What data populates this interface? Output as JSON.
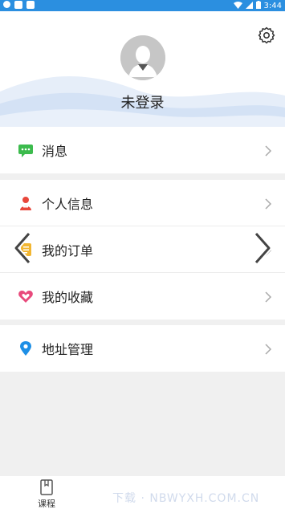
{
  "status_bar": {
    "time": "3:44"
  },
  "header": {
    "login_text": "未登录"
  },
  "menu": {
    "messages": "消息",
    "personal_info": "个人信息",
    "my_orders": "我的订单",
    "my_favorites": "我的收藏",
    "address_management": "地址管理"
  },
  "tabbar": {
    "courses_label": "课程"
  },
  "watermark": "下载 · NBWYXH.COM.CN",
  "colors": {
    "status_bar": "#2b8fe0",
    "message_icon": "#3cbb4d",
    "person_icon": "#e8473b",
    "heart_icon": "#e84a7c",
    "location_icon": "#1e8fe6",
    "wave": "#d4e2f5"
  }
}
